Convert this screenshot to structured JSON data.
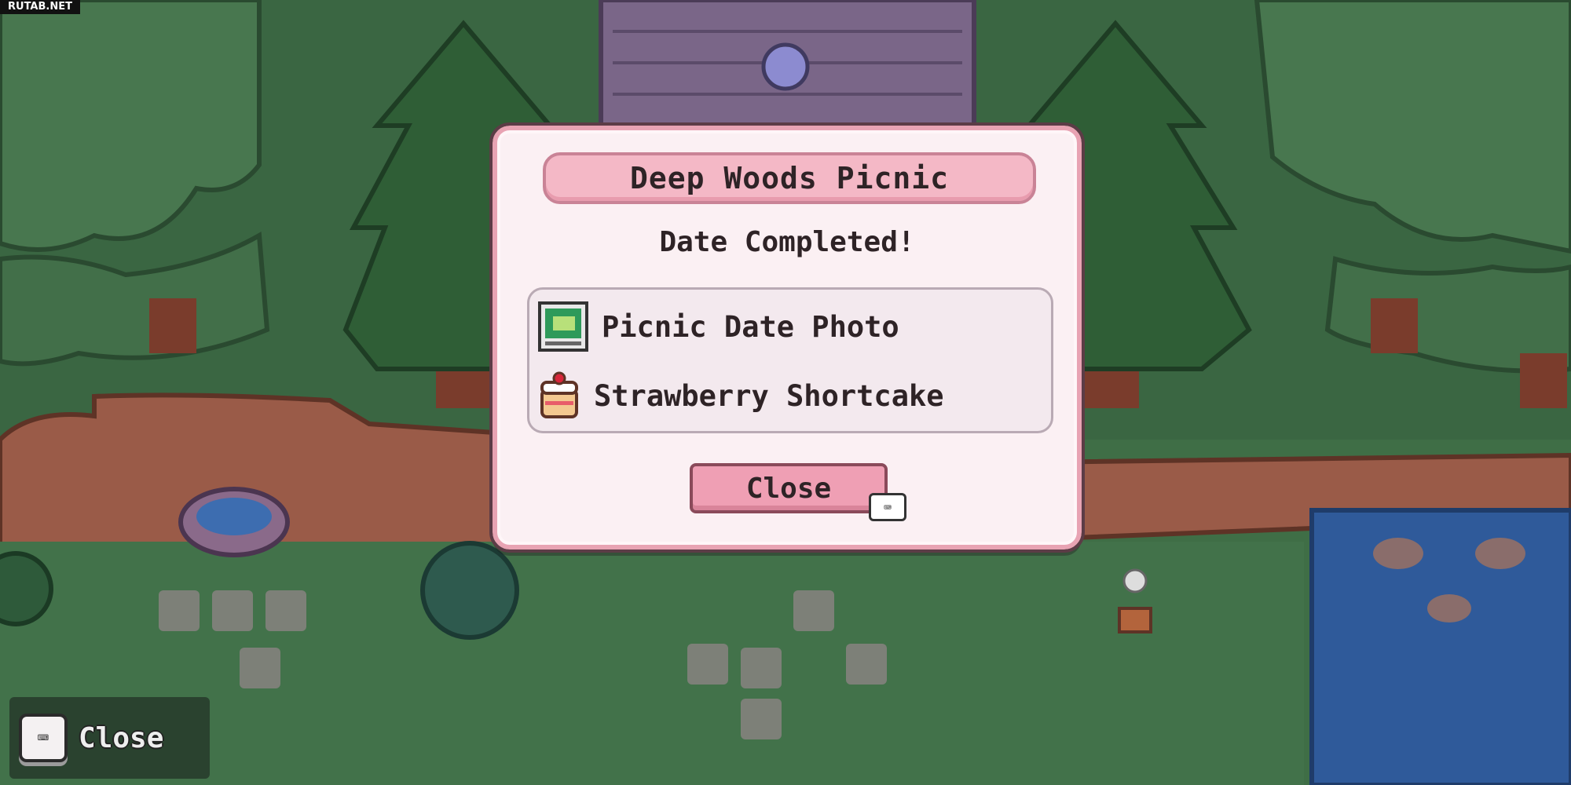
{
  "watermark": "RUTAB.NET",
  "dialog": {
    "title": "Deep Woods Picnic",
    "status": "Date Completed!",
    "rewards": [
      {
        "label": "Picnic Date Photo",
        "icon": "photo-icon"
      },
      {
        "label": "Strawberry Shortcake",
        "icon": "shortcake-icon"
      }
    ],
    "close_label": "Close",
    "close_key_icon": "keyboard-key-icon"
  },
  "prompt": {
    "label": "Close",
    "key_icon": "keyboard-key-icon"
  },
  "colors": {
    "dialog_bg": "#fbf0f3",
    "dialog_border": "#e8a3b3",
    "button_pink": "#ef9fb4",
    "grass": "#3f6e46",
    "water": "#2f5a9a"
  }
}
